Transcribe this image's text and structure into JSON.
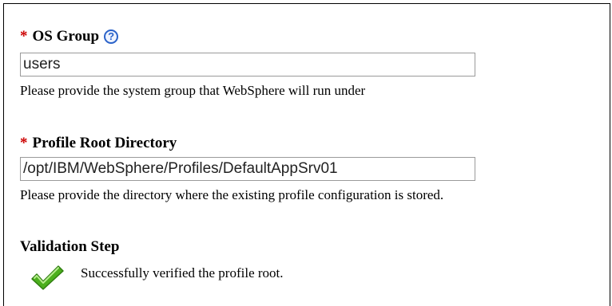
{
  "os_group": {
    "required_marker": "*",
    "label": "OS Group",
    "help_icon_glyph": "?",
    "value": "users",
    "help_text": "Please provide the system group that WebSphere will run under"
  },
  "profile_root": {
    "required_marker": "*",
    "label": "Profile Root Directory",
    "value": "/opt/IBM/WebSphere/Profiles/DefaultAppSrv01",
    "help_text": "Please provide the directory where the existing profile configuration is stored."
  },
  "validation": {
    "heading": "Validation Step",
    "status_icon": "checkmark-icon",
    "message": "Successfully verified the profile root."
  },
  "colors": {
    "required": "#cc0000",
    "help_icon": "#2a62c9",
    "success": "#4caf1e"
  }
}
